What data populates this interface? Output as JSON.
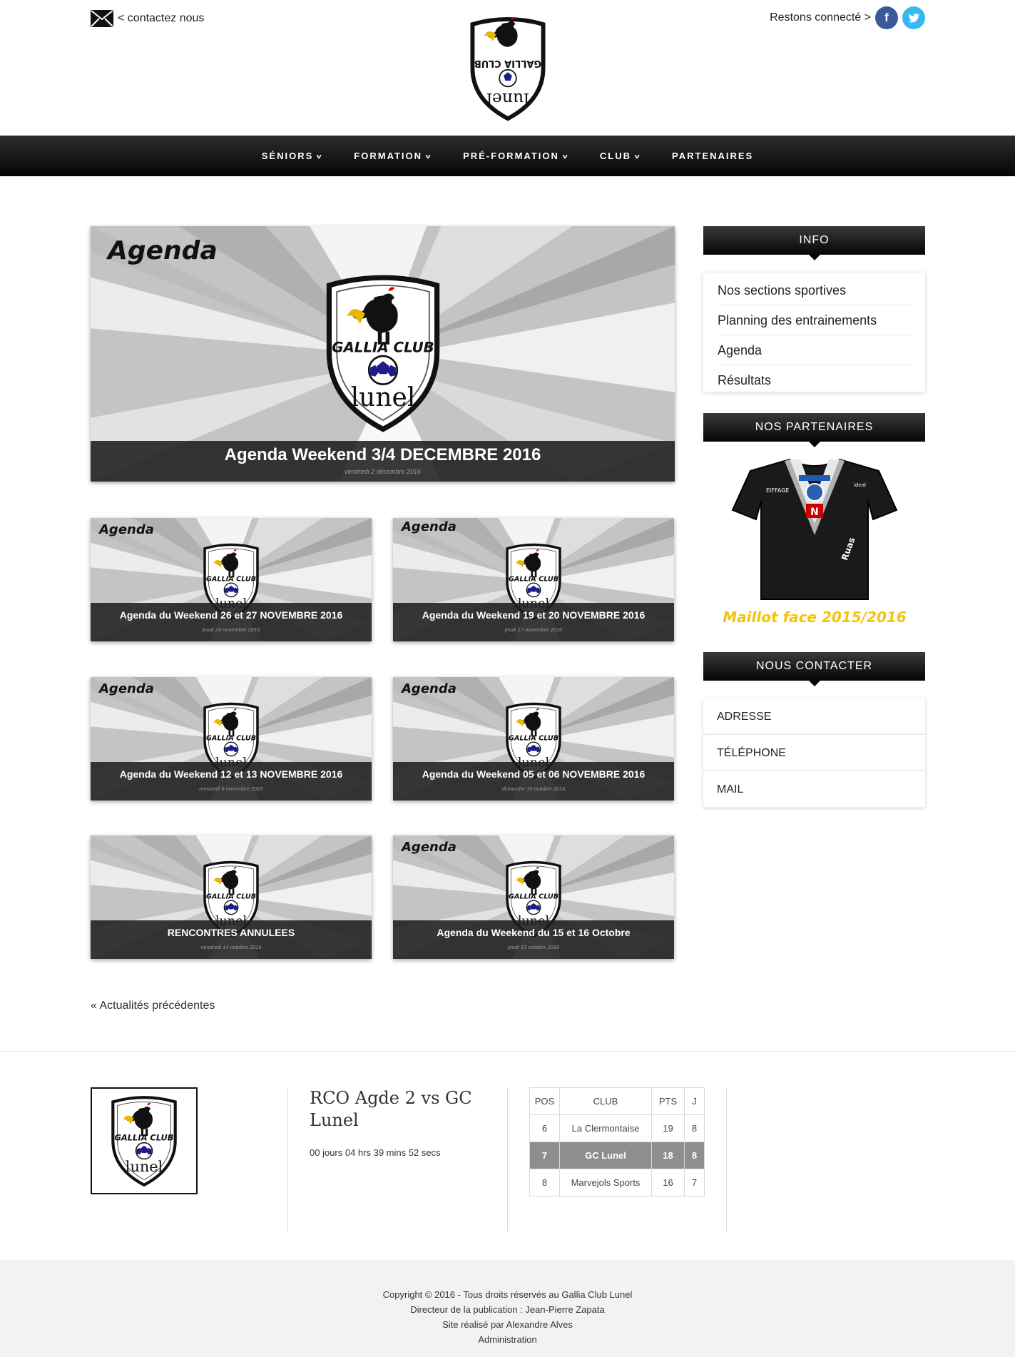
{
  "header": {
    "contact_label": "< contactez nous",
    "social_label": "Restons connecté >",
    "facebook_icon": "f",
    "twitter_icon": "t"
  },
  "logo": {
    "text_top": "GALLIA CLUB",
    "text_bottom": "lunel"
  },
  "nav": {
    "items": [
      {
        "label": "SÉNIORS",
        "dropdown": true
      },
      {
        "label": "FORMATION",
        "dropdown": true
      },
      {
        "label": "PRÉ-FORMATION",
        "dropdown": true
      },
      {
        "label": "CLUB",
        "dropdown": true
      },
      {
        "label": "PARTENAIRES",
        "dropdown": false
      }
    ],
    "chevron": "v"
  },
  "posts": {
    "overlay_word": "Agenda",
    "featured": {
      "title": "Agenda Weekend 3/4 DECEMBRE 2016",
      "date": "vendredi 2 décembre 2016"
    },
    "grid": [
      {
        "title": "Agenda du Weekend 26 et 27 NOVEMBRE 2016",
        "date": "jeudi 24 novembre 2016",
        "show_word": true
      },
      {
        "title": "Agenda du Weekend 19 et 20 NOVEMBRE 2016",
        "date": "jeudi 17 novembre 2016",
        "show_word": true
      },
      {
        "title": "Agenda du Weekend 12 et 13 NOVEMBRE 2016",
        "date": "mercredi 9 novembre 2016",
        "show_word": true
      },
      {
        "title": "Agenda du Weekend 05 et 06 NOVEMBRE 2016",
        "date": "dimanche 30 octobre 2016",
        "show_word": true
      },
      {
        "title": "RENCONTRES ANNULEES",
        "date": "vendredi 14 octobre 2016",
        "show_word": false
      },
      {
        "title": "Agenda du Weekend du 15 et 16 Octobre",
        "date": "jeudi 13 octobre 2016",
        "show_word": true
      }
    ],
    "previous_link": "« Actualités précédentes"
  },
  "sidebar": {
    "info_title": "INFO",
    "info_items": [
      "Nos sections sportives",
      "Planning des entrainements",
      "Agenda",
      "Résultats"
    ],
    "partners_title": "NOS PARTENAIRES",
    "partner_caption": "Maillot face 2015/2016",
    "contact_title": "NOUS CONTACTER",
    "contact_items": [
      "ADRESSE",
      "TÉLÉPHONE",
      "MAIL"
    ]
  },
  "footer_widgets": {
    "match_title": "RCO Agde 2 vs GC Lunel",
    "countdown": "00 jours 04 hrs 39 mins 52 secs",
    "standings": {
      "headers": [
        "POS",
        "CLUB",
        "PTS",
        "J"
      ],
      "rows": [
        {
          "pos": "6",
          "club": "La Clermontaise",
          "pts": "19",
          "j": "8",
          "highlight": false
        },
        {
          "pos": "7",
          "club": "GC Lunel",
          "pts": "18",
          "j": "8",
          "highlight": true
        },
        {
          "pos": "8",
          "club": "Marvejols Sports",
          "pts": "16",
          "j": "7",
          "highlight": false
        }
      ]
    }
  },
  "footer": {
    "copyright": "Copyright © 2016 - Tous droits réservés au Gallia Club Lunel",
    "director": "Directeur de la publication : Jean-Pierre Zapata",
    "credit": "Site réalisé par Alexandre Alves",
    "admin": "Administration"
  },
  "colors": {
    "facebook": "#3b5998",
    "twitter": "#38b7f1",
    "nav_bg": "#111111",
    "highlight_row": "#8e8e8e"
  }
}
